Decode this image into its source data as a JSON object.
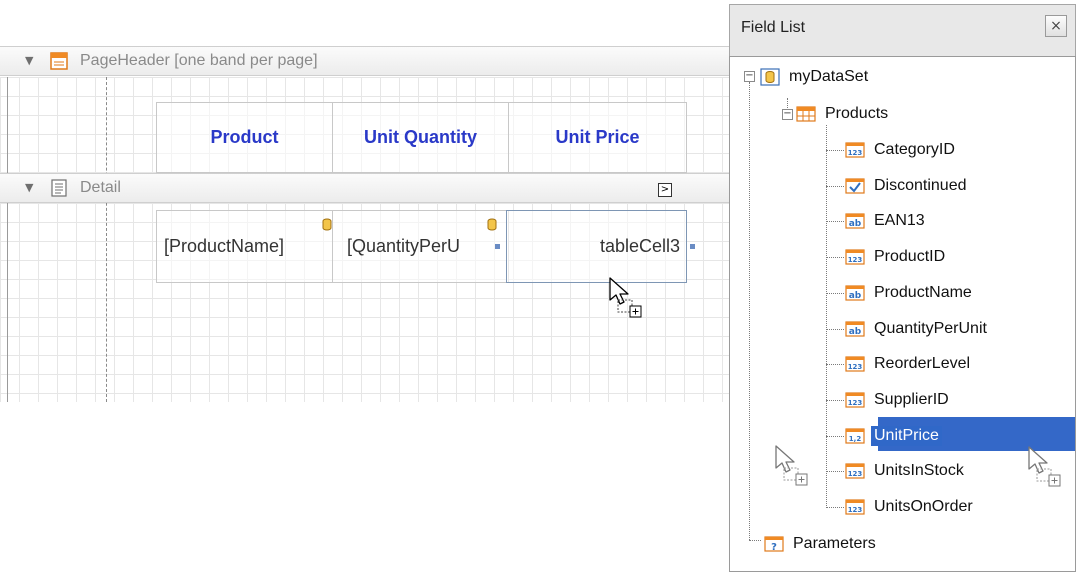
{
  "report": {
    "page_header_band": {
      "title": "PageHeader [one band per page]"
    },
    "detail_band": {
      "title": "Detail"
    },
    "header_cells": [
      "Product",
      "Unit Quantity",
      "Unit Price"
    ],
    "detail_cells": [
      "[ProductName]",
      "[QuantityPerU",
      "tableCell3"
    ]
  },
  "field_list": {
    "title": "Field List",
    "close_glyph": "×",
    "datasource": "myDataSet",
    "table": "Products",
    "fields": [
      {
        "name": "CategoryID",
        "type_icon": "123"
      },
      {
        "name": "Discontinued",
        "type_icon": "checkbox"
      },
      {
        "name": "EAN13",
        "type_icon": "ab"
      },
      {
        "name": "ProductID",
        "type_icon": "123"
      },
      {
        "name": "ProductName",
        "type_icon": "ab"
      },
      {
        "name": "QuantityPerUnit",
        "type_icon": "ab"
      },
      {
        "name": "ReorderLevel",
        "type_icon": "123"
      },
      {
        "name": "SupplierID",
        "type_icon": "123"
      },
      {
        "name": "UnitPrice",
        "type_icon": "1,2"
      },
      {
        "name": "UnitsInStock",
        "type_icon": "123"
      },
      {
        "name": "UnitsOnOrder",
        "type_icon": "123"
      }
    ],
    "selected_field": "UnitPrice",
    "parameters": "Parameters"
  },
  "colors": {
    "header_text": "#2a39c8",
    "selection": "#3068c8",
    "icon_orange": "#f08a24"
  }
}
